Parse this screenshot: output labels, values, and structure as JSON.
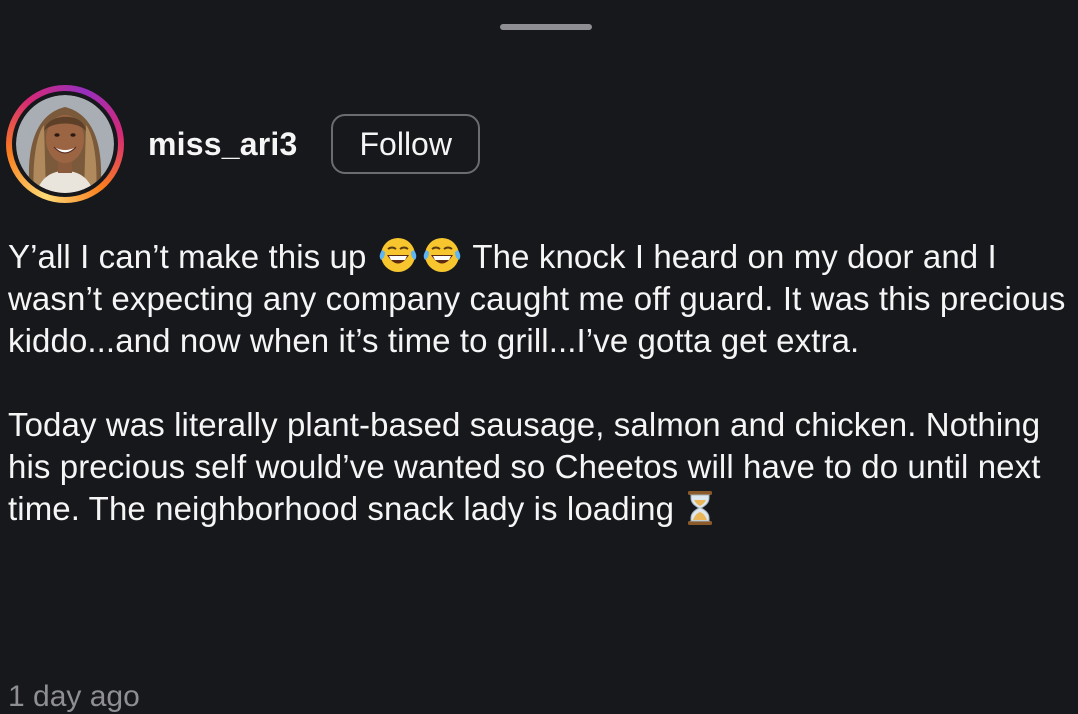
{
  "post": {
    "username": "miss_ari3",
    "follow_label": "Follow",
    "caption": {
      "p1_part1": "Y’all I can’t make this up",
      "p1_emojis": [
        "laughing-tears-emoji",
        "laughing-tears-emoji"
      ],
      "p1_part2": "The knock I heard on my door and I wasn’t expecting any company caught me off guard. It was this precious kiddo...and now when it’s time to grill...I’ve gotta get extra.",
      "p2_text": "Today was literally plant-based sausage, salmon and chicken. Nothing his precious self would’ve wanted so Cheetos will have to do until next time. The neighborhood snack lady is loading",
      "p2_emoji": "hourglass-emoji"
    },
    "timestamp": "1 day ago"
  },
  "colors": {
    "background": "#17181c",
    "text": "#f5f5f5",
    "muted": "#8e8e93",
    "button_border": "#6b6b70"
  }
}
